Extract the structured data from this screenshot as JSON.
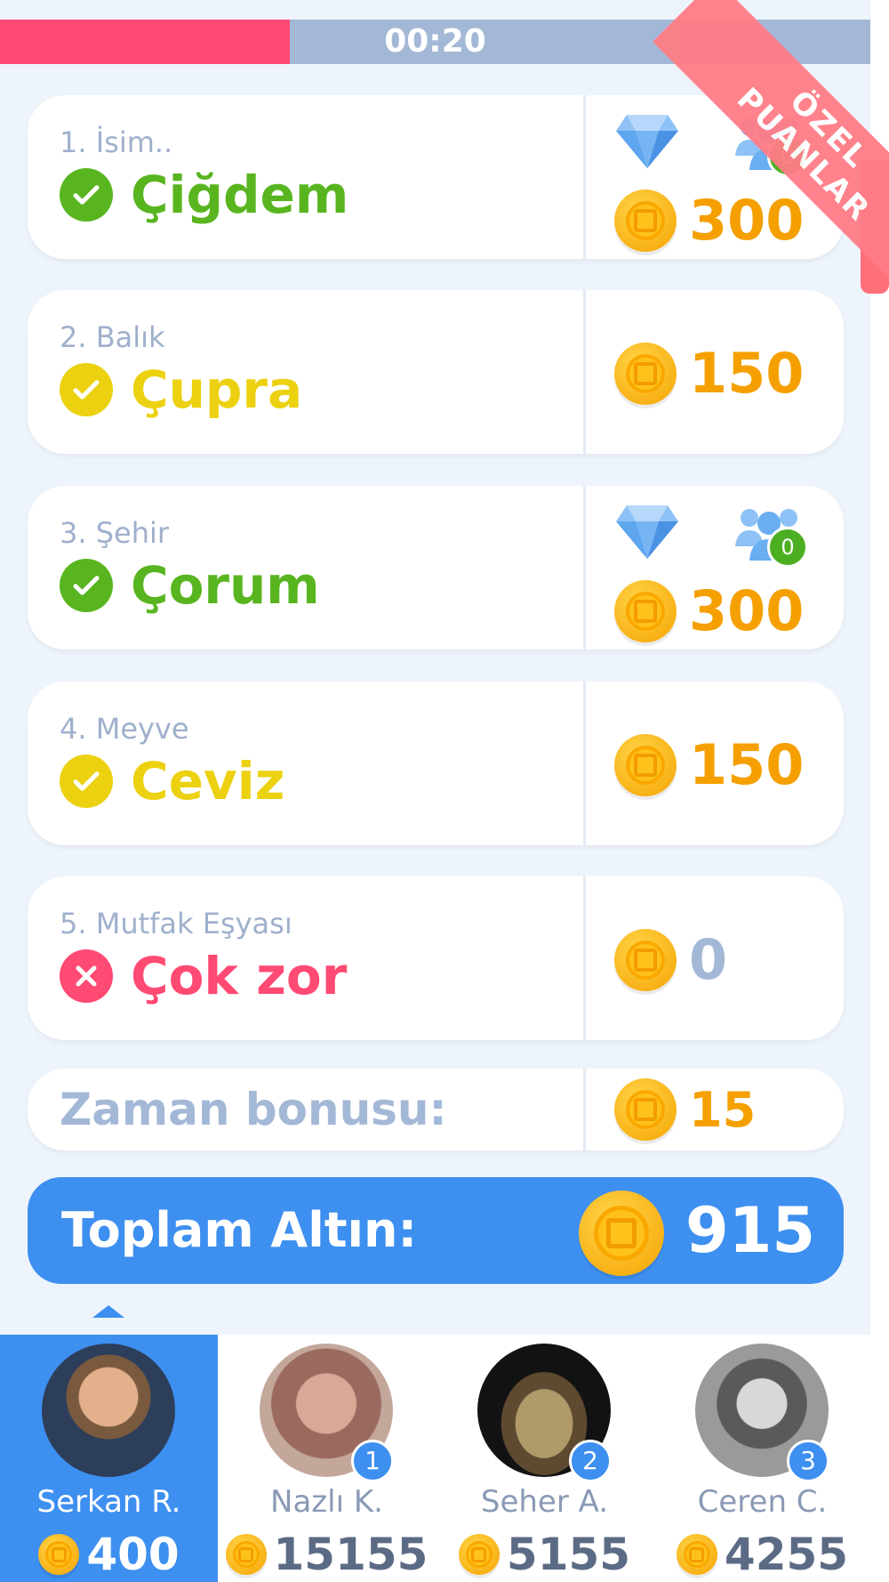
{
  "timer": {
    "text": "00:20",
    "remaining_fraction": 0.333
  },
  "ribbon": {
    "line1": "ÖZEL",
    "line2": "PUANLAR"
  },
  "answers": [
    {
      "category": "1. İsim..",
      "answer": "Çiğdem",
      "status": "correct",
      "points": "300",
      "extras": {
        "gem": true,
        "friends": "0"
      }
    },
    {
      "category": "2. Balık",
      "answer": "Çupra",
      "status": "partial",
      "points": "150"
    },
    {
      "category": "3. Şehir",
      "answer": "Çorum",
      "status": "correct",
      "points": "300",
      "extras": {
        "gem": true,
        "friends": "0"
      }
    },
    {
      "category": "4. Meyve",
      "answer": "Ceviz",
      "status": "partial",
      "points": "150"
    },
    {
      "category": "5. Mutfak Eşyası",
      "answer": "Çok zor",
      "status": "wrong",
      "points": "0"
    }
  ],
  "bonus": {
    "label": "Zaman bonusu:",
    "points": "15"
  },
  "total": {
    "label": "Toplam Altın:",
    "value": "915"
  },
  "colors": {
    "correct": "#58b51f",
    "partial": "#ecd110",
    "wrong": "#ff4a73",
    "accent": "#3d8ff0",
    "gold": "#f5a000",
    "muted": "#9fb0cc"
  },
  "players": [
    {
      "name": "Serkan R.",
      "score": "400",
      "rank": "",
      "current": true
    },
    {
      "name": "Nazlı K.",
      "score": "15155",
      "rank": "1"
    },
    {
      "name": "Seher A.",
      "score": "5155",
      "rank": "2"
    },
    {
      "name": "Ceren C.",
      "score": "4255",
      "rank": "3"
    }
  ]
}
